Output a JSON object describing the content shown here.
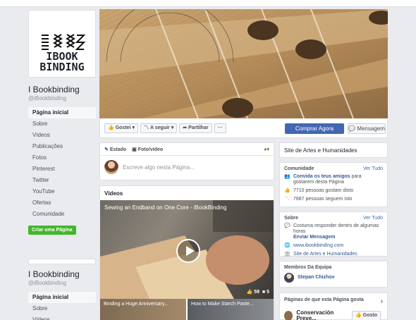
{
  "logo": {
    "text_line1": "IBOOK",
    "text_line2": "BINDING"
  },
  "page": {
    "name": "I Bookbinding",
    "handle": "@iBookbinding"
  },
  "nav": [
    {
      "label": "Página inicial",
      "active": true
    },
    {
      "label": "Sobre"
    },
    {
      "label": "Vídeos"
    },
    {
      "label": "Publicações"
    },
    {
      "label": "Fotos"
    },
    {
      "label": "Pinterest"
    },
    {
      "label": "Twitter"
    },
    {
      "label": "YouTube"
    },
    {
      "label": "Ofertas"
    },
    {
      "label": "Comunidade"
    }
  ],
  "create_page_label": "Criar uma Página",
  "nav2": [
    {
      "label": "Página inicial",
      "active": true
    },
    {
      "label": "Sobre"
    },
    {
      "label": "Vídeos"
    }
  ],
  "actions": {
    "like": "Gostei",
    "follow": "A seguir",
    "share": "Partilhar",
    "more": "···",
    "buy": "Comprar Agora",
    "message": "Mensagem"
  },
  "composer": {
    "tab_status": "Estado",
    "tab_photo": "Foto/vídeo",
    "placeholder": "Escreve algo nesta Página..."
  },
  "videos": {
    "title": "Vídeos",
    "main_title": "Sewing an Endband on One Core - iBookBinding",
    "likes": "59",
    "comments": "5",
    "thumb1": "Binding a Huge Anniversary...",
    "thumb2": "How to Make Starch Paste..."
  },
  "right": {
    "category_title": "Site de Artes e Humanidades",
    "community": {
      "heading": "Comunidade",
      "see_all": "Ver Tudo",
      "invite_link": "Convida os teus amigos",
      "invite_rest": "para gostarem desta Página",
      "likes": "7710 pessoas gostam disto",
      "follows": "7887 pessoas seguem isto"
    },
    "about": {
      "heading": "Sobre",
      "see_all": "Ver Tudo",
      "response": "Costuma responder dentro de algumas horas",
      "send_message": "Enviar Mensagem",
      "website": "www.ibookbinding.com",
      "category": "Site de Artes e Humanidades"
    },
    "team": {
      "heading": "Membros Da Equipa",
      "member": "Stepan Chizhov"
    },
    "liked_pages": {
      "heading": "Páginas de que esta Página gosta",
      "page": "Conservación Preve...",
      "like_btn": "Gosto"
    }
  },
  "colors": {
    "accent": "#4267b2",
    "create": "#42b72a",
    "bg": "#e9ebee"
  }
}
